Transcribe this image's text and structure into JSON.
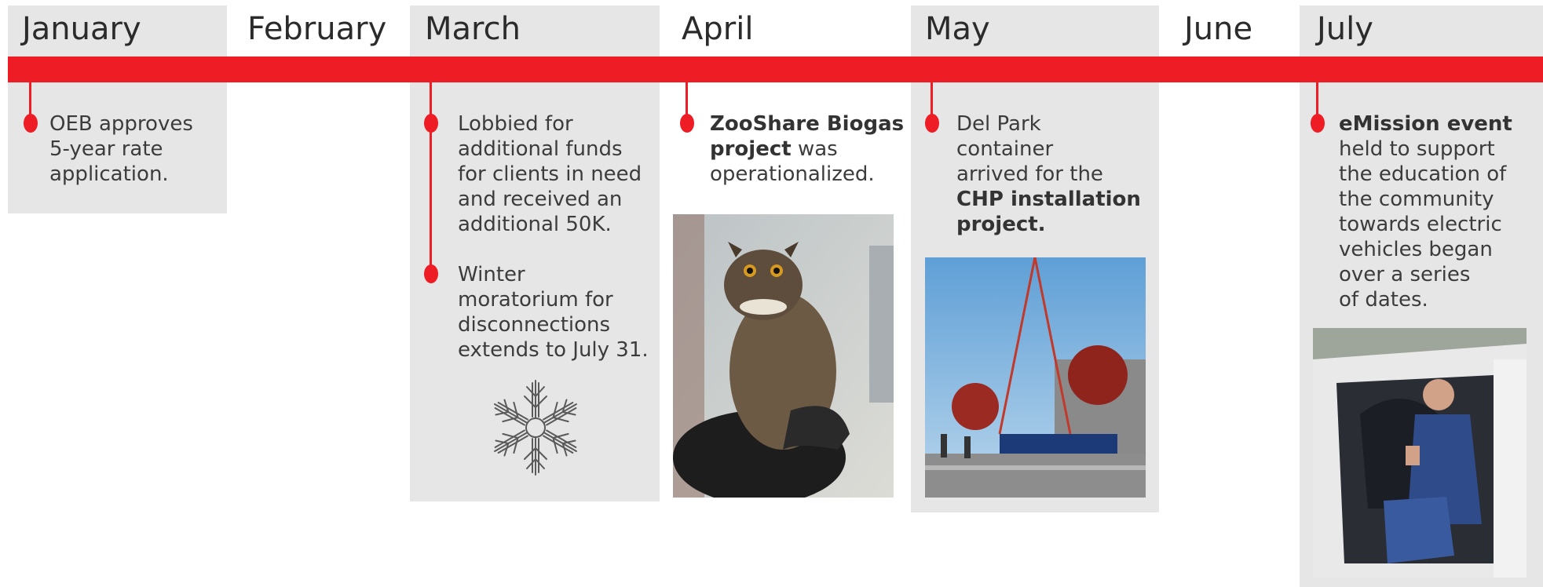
{
  "months": {
    "jan": "January",
    "feb": "February",
    "mar": "March",
    "apr": "April",
    "may": "May",
    "jun": "June",
    "jul": "July"
  },
  "events": {
    "jan": "OEB approves\n5-year rate\napplication.",
    "mar1": "Lobbied for\nadditional funds\nfor clients in need\nand received an\nadditional 50K.",
    "mar2": "Winter\nmoratorium for\ndisconnections\nextends to July 31.",
    "apr_bold": "ZooShare Biogas\nproject",
    "apr_rest": " was\noperationalized.",
    "may_pre": "Del Park\ncontainer\narrived for the\n",
    "may_bold": "CHP installation\nproject.",
    "jul_bold": "eMission event",
    "jul_rest": "\nheld to support\nthe education of\nthe community\ntowards electric\nvehicles began\nover a series\nof dates."
  },
  "images": {
    "snowflake": "snowflake-icon",
    "owl": "owl-photo",
    "container": "container-crane-photo",
    "car": "man-in-electric-car-photo"
  },
  "colors": {
    "accent": "#ee1c25",
    "panel": "#e6e6e7",
    "text": "#3c3c3c"
  }
}
